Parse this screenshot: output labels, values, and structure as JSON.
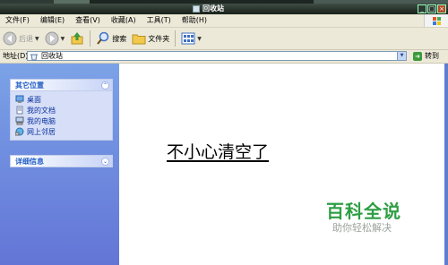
{
  "window": {
    "title": "回收站"
  },
  "menubar": {
    "items": [
      "文件(F)",
      "编辑(E)",
      "查看(V)",
      "收藏(A)",
      "工具(T)",
      "帮助(H)"
    ]
  },
  "toolbar": {
    "back_label": "后退",
    "search_label": "搜索",
    "folders_label": "文件夹"
  },
  "address": {
    "label": "地址(D)",
    "value": "回收站",
    "go_label": "转到"
  },
  "sidebar": {
    "other_places": {
      "title": "其它位置",
      "items": [
        {
          "label": "桌面",
          "icon": "desktop-icon"
        },
        {
          "label": "我的文档",
          "icon": "my-documents-icon"
        },
        {
          "label": "我的电脑",
          "icon": "my-computer-icon"
        },
        {
          "label": "网上邻居",
          "icon": "network-places-icon"
        }
      ]
    },
    "details": {
      "title": "详细信息"
    }
  },
  "main": {
    "caption": "不小心清空了"
  },
  "watermark": {
    "title": "百科全说",
    "subtitle": "助你轻松解决",
    "color": "#2e9e44"
  }
}
